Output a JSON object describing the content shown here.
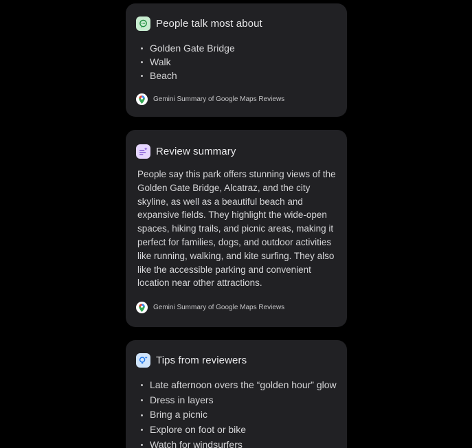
{
  "colors": {
    "page_background": "#000000",
    "card_background": "#212124",
    "accent_green": "#c8ecd0",
    "accent_purple": "#e6d6ff",
    "accent_blue": "#cfe4fb"
  },
  "cards": [
    {
      "title": "People talk most about",
      "icon": "chat-bubble-icon",
      "bullets": [
        "Golden Gate Bridge",
        "Walk",
        "Beach"
      ],
      "attribution": "Gemini Summary of Google Maps Reviews",
      "attribution_icon": "google-maps-pin-icon"
    },
    {
      "title": "Review summary",
      "icon": "sparkle-text-icon",
      "body": "People say this park offers stunning views of the Golden Gate Bridge, Alcatraz, and the city skyline, as well as a beautiful beach and expansive fields. They highlight the wide-open spaces, hiking trails, and picnic areas, making it perfect for families, dogs, and outdoor activities like running, walking, and kite surfing. They also like the accessible parking and convenient location near other attractions.",
      "attribution": "Gemini Summary of Google Maps Reviews",
      "attribution_icon": "google-maps-pin-icon"
    },
    {
      "title": "Tips from reviewers",
      "icon": "lightbulb-sparkle-icon",
      "bullets": [
        "Late afternoon overs the “golden hour” glow",
        "Dress in layers",
        "Bring a picnic",
        "Explore on foot or bike",
        "Watch for windsurfers"
      ]
    }
  ]
}
